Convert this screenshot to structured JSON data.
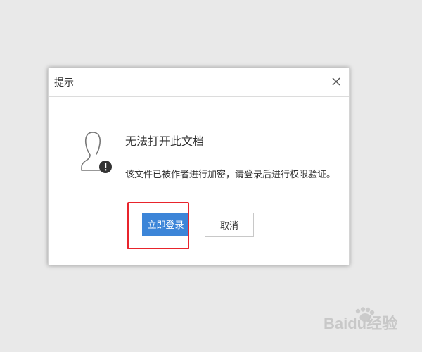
{
  "dialog": {
    "title": "提示",
    "close_label": "x",
    "headline": "无法打开此文档",
    "message": "该文件已被作者进行加密，请登录后进行权限验证。",
    "login_button": "立即登录",
    "cancel_button": "取消"
  },
  "colors": {
    "primary_button": "#3c85d8",
    "highlight_border": "#e8242c"
  },
  "watermark": {
    "text": "Baidu经验"
  }
}
